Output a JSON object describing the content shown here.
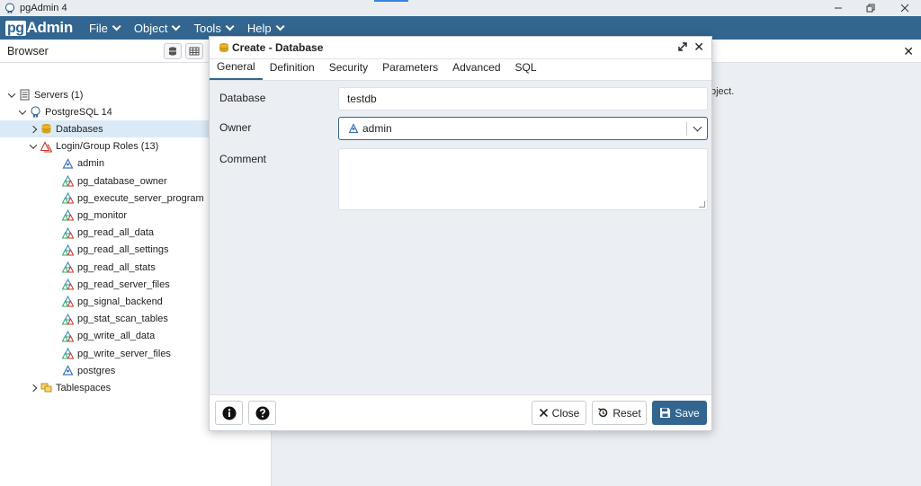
{
  "os_window": {
    "title": "pgAdmin 4",
    "controls": [
      "minimize",
      "restore",
      "close"
    ]
  },
  "menubar": {
    "logo_pg": "pg",
    "logo_admin": "Admin",
    "items": [
      {
        "label": "File"
      },
      {
        "label": "Object"
      },
      {
        "label": "Tools"
      },
      {
        "label": "Help"
      }
    ]
  },
  "browser": {
    "title": "Browser",
    "tree": [
      {
        "label": "Servers (1)",
        "icon": "servers-icon",
        "expander": "down"
      },
      {
        "label": "PostgreSQL 14",
        "icon": "postgres-elephant-icon",
        "expander": "down"
      },
      {
        "label": "Databases",
        "icon": "databases-icon",
        "expander": "right",
        "selected": true
      },
      {
        "label": "Login/Group Roles (13)",
        "icon": "roles-icon",
        "expander": "down"
      },
      {
        "label": "admin",
        "icon": "user-icon"
      },
      {
        "label": "pg_database_owner",
        "icon": "group-icon"
      },
      {
        "label": "pg_execute_server_program",
        "icon": "group-icon"
      },
      {
        "label": "pg_monitor",
        "icon": "group-icon"
      },
      {
        "label": "pg_read_all_data",
        "icon": "group-icon"
      },
      {
        "label": "pg_read_all_settings",
        "icon": "group-icon"
      },
      {
        "label": "pg_read_all_stats",
        "icon": "group-icon"
      },
      {
        "label": "pg_read_server_files",
        "icon": "group-icon"
      },
      {
        "label": "pg_signal_backend",
        "icon": "group-icon"
      },
      {
        "label": "pg_stat_scan_tables",
        "icon": "group-icon"
      },
      {
        "label": "pg_write_all_data",
        "icon": "group-icon"
      },
      {
        "label": "pg_write_server_files",
        "icon": "group-icon"
      },
      {
        "label": "postgres",
        "icon": "user-icon"
      },
      {
        "label": "Tablespaces",
        "icon": "tablespaces-icon",
        "expander": "right"
      }
    ]
  },
  "right_panel": {
    "hint_fragment": "bject."
  },
  "dialog": {
    "title": "Create - Database",
    "tabs": [
      {
        "label": "General",
        "active": true
      },
      {
        "label": "Definition"
      },
      {
        "label": "Security"
      },
      {
        "label": "Parameters"
      },
      {
        "label": "Advanced"
      },
      {
        "label": "SQL"
      }
    ],
    "fields": {
      "database_label": "Database",
      "database_value": "testdb",
      "owner_label": "Owner",
      "owner_value": "admin",
      "comment_label": "Comment",
      "comment_value": ""
    },
    "footer": {
      "info_icon": "info-icon",
      "help_icon": "help-icon",
      "close_label": "Close",
      "reset_label": "Reset",
      "save_label": "Save"
    }
  },
  "colors": {
    "brand": "#326690",
    "selected_row": "#dbeaf7",
    "dialog_bg": "#ebeef3"
  }
}
